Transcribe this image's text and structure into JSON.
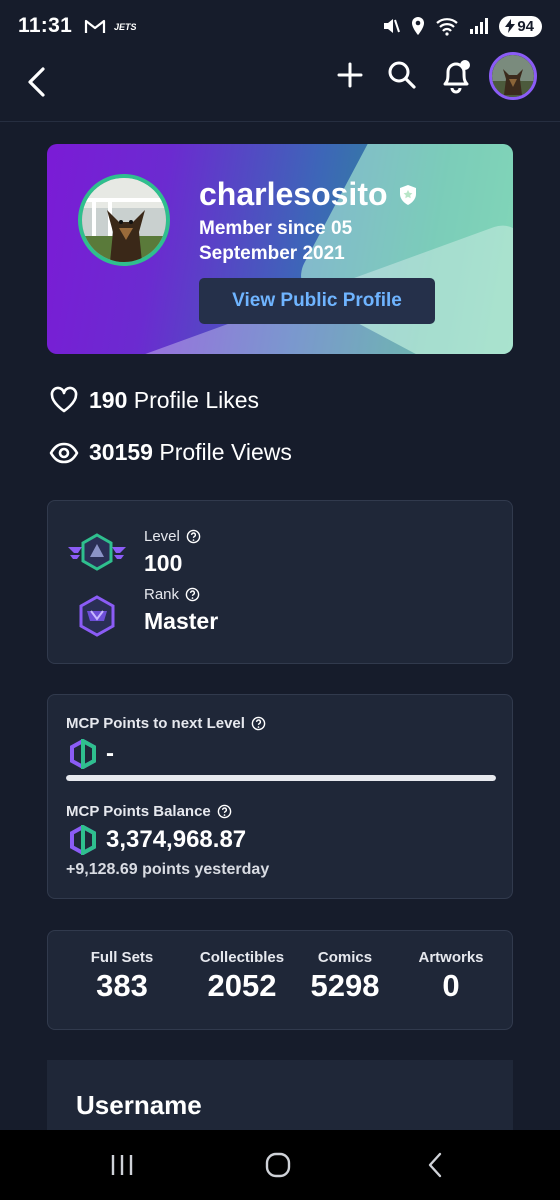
{
  "status_bar": {
    "time": "11:31",
    "battery": "94"
  },
  "app_bar": {
    "icons": [
      "back-icon",
      "plus-icon",
      "search-icon",
      "bell-icon",
      "avatar"
    ]
  },
  "profile": {
    "username": "charlesosito",
    "member_since": "Member since 05 September 2021",
    "view_button": "View Public Profile"
  },
  "stats": {
    "likes_value": "190",
    "likes_label": "Profile Likes",
    "views_value": "30159",
    "views_label": "Profile Views"
  },
  "level_card": {
    "level_label": "Level",
    "level_value": "100",
    "rank_label": "Rank",
    "rank_value": "Master"
  },
  "mcp_card": {
    "next_label": "MCP Points to next Level",
    "next_value": "-",
    "progress": 1.0,
    "balance_label": "MCP Points Balance",
    "balance_value": "3,374,968.87",
    "yesterday": "+9,128.69 points yesterday"
  },
  "counts": [
    {
      "label": "Full Sets",
      "value": "383"
    },
    {
      "label": "Collectibles",
      "value": "2052"
    },
    {
      "label": "Comics",
      "value": "5298"
    },
    {
      "label": "Artworks",
      "value": "0"
    }
  ],
  "username_section": {
    "title": "Username"
  },
  "colors": {
    "background": "#161c2b",
    "card": "#1f2738",
    "accent_link": "#6fb4ff",
    "avatar_ring": "#2fbf8e"
  }
}
